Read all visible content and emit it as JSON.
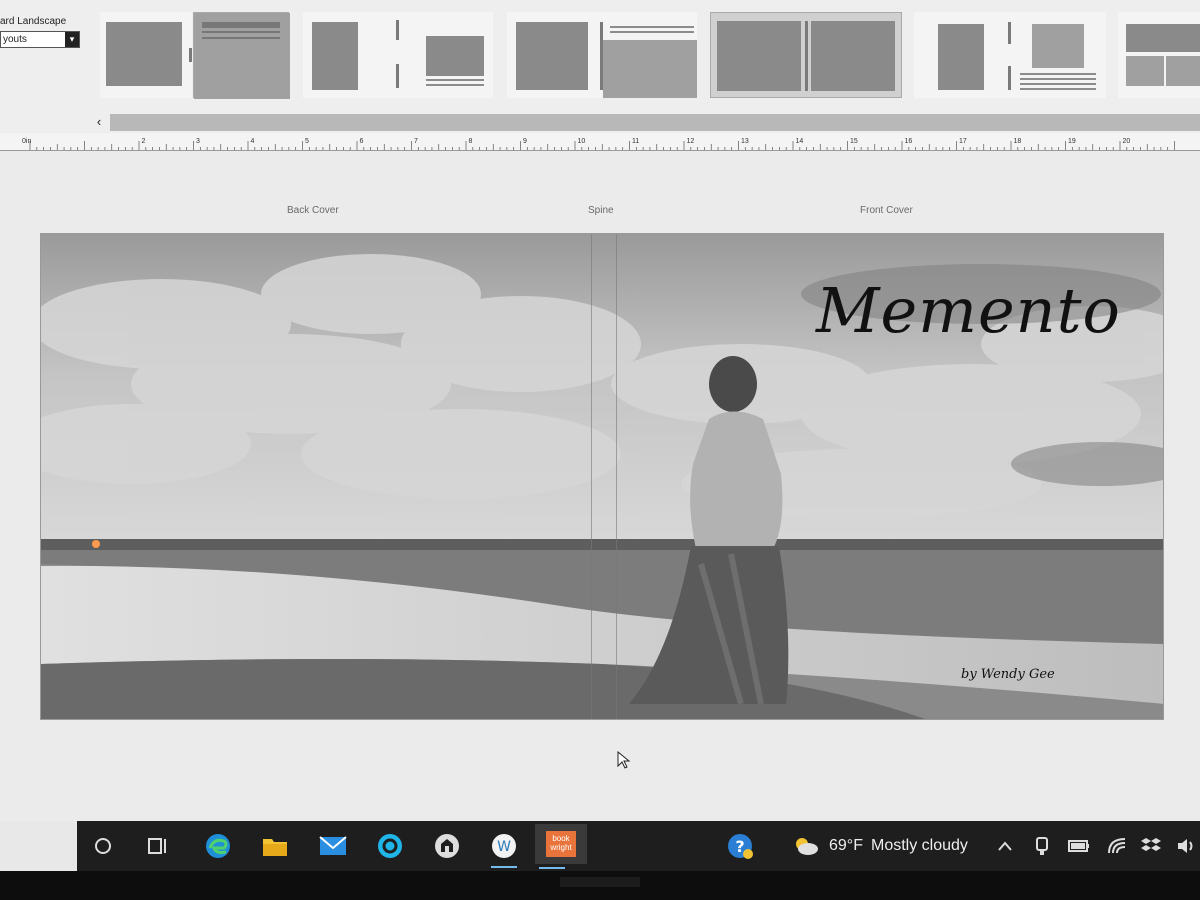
{
  "layout_panel": {
    "size_label": "ard Landscape",
    "layouts_select_value": "youts"
  },
  "ruler": {
    "origin_label": "0in",
    "numbers": [
      "2",
      "3",
      "4",
      "5",
      "6",
      "7",
      "8",
      "9",
      "10",
      "11",
      "12",
      "13",
      "14",
      "15",
      "16",
      "17",
      "18",
      "19",
      "20"
    ]
  },
  "cover": {
    "back_cover_label": "Back Cover",
    "spine_label": "Spine",
    "front_cover_label": "Front Cover",
    "title": "Memento",
    "author": "by Wendy Gee"
  },
  "taskbar": {
    "weather_temp": "69°F",
    "weather_desc": "Mostly cloudy",
    "bookwright_label": "book\nwright",
    "wordpress_glyph": "W",
    "help_glyph": "?"
  },
  "colors": {
    "taskbar_bg": "#1e1e1e",
    "active_indicator": "#76b9ed",
    "bookwright_orange": "#e8743b"
  }
}
